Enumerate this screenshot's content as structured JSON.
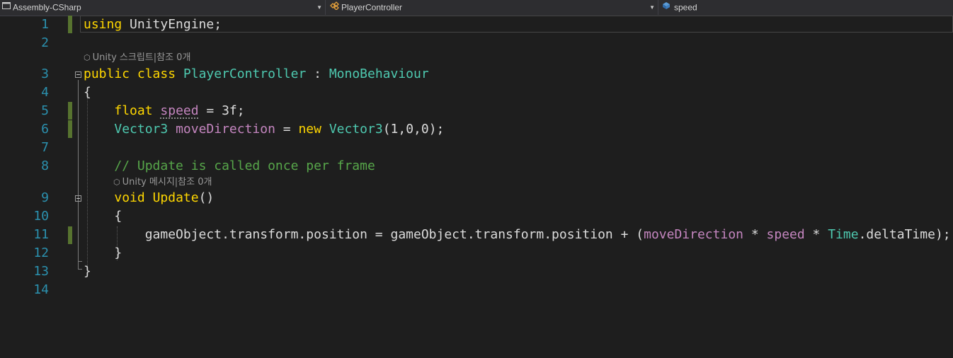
{
  "navbar": {
    "project": {
      "label": "Assembly-CSharp",
      "icon": "csharp-project-icon"
    },
    "type": {
      "label": "PlayerController",
      "icon": "class-icon"
    },
    "member": {
      "label": "speed",
      "icon": "field-icon"
    }
  },
  "colors": {
    "line_number": "#2b91af",
    "keyword": "#ffd700",
    "type": "#4ec9b0",
    "field": "#c586c0",
    "comment": "#57a64a",
    "text": "#dcdcdc",
    "change_bar": "#57732f"
  },
  "codelens": [
    {
      "text": "Unity 스크립트|참조 0개"
    },
    {
      "text": "Unity 메시지|참조 0개"
    }
  ],
  "lines": [
    {
      "number": "1",
      "tokens": [
        [
          "kw",
          "using"
        ],
        [
          "plain",
          " UnityEngine;"
        ]
      ]
    },
    {
      "number": "2",
      "tokens": []
    },
    {
      "number": "3",
      "tokens": [
        [
          "kw",
          "public"
        ],
        [
          "plain",
          " "
        ],
        [
          "kw",
          "class"
        ],
        [
          "plain",
          " "
        ],
        [
          "type",
          "PlayerController"
        ],
        [
          "plain",
          " : "
        ],
        [
          "type",
          "MonoBehaviour"
        ]
      ]
    },
    {
      "number": "4",
      "tokens": [
        [
          "plain",
          "{"
        ]
      ]
    },
    {
      "number": "5",
      "tokens": [
        [
          "plain",
          "    "
        ],
        [
          "kw",
          "float"
        ],
        [
          "plain",
          " "
        ],
        [
          "field-sq",
          "speed"
        ],
        [
          "plain",
          " = 3f;"
        ]
      ]
    },
    {
      "number": "6",
      "tokens": [
        [
          "plain",
          "    "
        ],
        [
          "type",
          "Vector3"
        ],
        [
          "plain",
          " "
        ],
        [
          "field",
          "moveDirection"
        ],
        [
          "plain",
          " = "
        ],
        [
          "kw",
          "new"
        ],
        [
          "plain",
          " "
        ],
        [
          "type",
          "Vector3"
        ],
        [
          "plain",
          "(1,0,0);"
        ]
      ]
    },
    {
      "number": "7",
      "tokens": []
    },
    {
      "number": "8",
      "tokens": [
        [
          "plain",
          "    "
        ],
        [
          "comment",
          "// Update is called once per frame"
        ]
      ]
    },
    {
      "number": "9",
      "tokens": [
        [
          "plain",
          "    "
        ],
        [
          "kw",
          "void"
        ],
        [
          "plain",
          " "
        ],
        [
          "method",
          "Update"
        ],
        [
          "plain",
          "()"
        ]
      ]
    },
    {
      "number": "10",
      "tokens": [
        [
          "plain",
          "    {"
        ]
      ]
    },
    {
      "number": "11",
      "tokens": [
        [
          "plain",
          "        gameObject.transform.position = gameObject.transform.position + ("
        ],
        [
          "field",
          "moveDirection"
        ],
        [
          "plain",
          " * "
        ],
        [
          "field",
          "speed"
        ],
        [
          "plain",
          " * "
        ],
        [
          "type",
          "Time"
        ],
        [
          "plain",
          ".deltaTime);"
        ]
      ]
    },
    {
      "number": "12",
      "tokens": [
        [
          "plain",
          "    }"
        ]
      ]
    },
    {
      "number": "13",
      "tokens": [
        [
          "plain",
          "}"
        ]
      ]
    },
    {
      "number": "14",
      "tokens": []
    }
  ]
}
